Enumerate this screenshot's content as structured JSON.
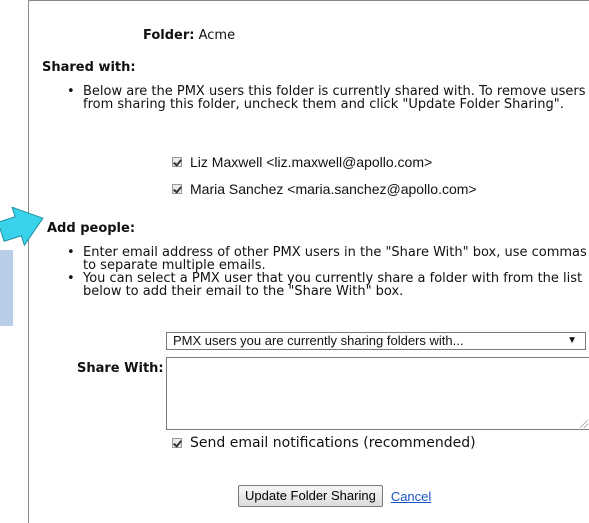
{
  "folder": {
    "label": "Folder:",
    "name": "Acme"
  },
  "shared_with": {
    "heading": "Shared with:",
    "bullets": [
      "Below are the PMX users this folder is currently shared with. To remove users from sharing this folder, uncheck them and click \"Update Folder Sharing\"."
    ],
    "users": [
      {
        "label": "Liz Maxwell <liz.maxwell@apollo.com>",
        "checked": true
      },
      {
        "label": "Maria Sanchez <maria.sanchez@apollo.com>",
        "checked": true
      }
    ]
  },
  "add_people": {
    "heading": "Add people:",
    "bullets": [
      "Enter email address of other PMX users in the \"Share With\" box, use commas to separate multiple emails.",
      "You can select a PMX user that you currently share a folder with from the list below to add their email to the \"Share With\" box."
    ]
  },
  "select": {
    "value": "PMX users you are currently sharing folders with...",
    "arrow": "▼"
  },
  "share_with": {
    "label": "Share With:",
    "value": ""
  },
  "notify": {
    "label": "Send email notifications (recommended)",
    "checked": true
  },
  "actions": {
    "update_label": "Update Folder Sharing",
    "cancel_label": "Cancel"
  },
  "colors": {
    "arrow_fill": "#38d3ea",
    "left_tab": "#b9cde6",
    "link": "#1a55c8"
  }
}
